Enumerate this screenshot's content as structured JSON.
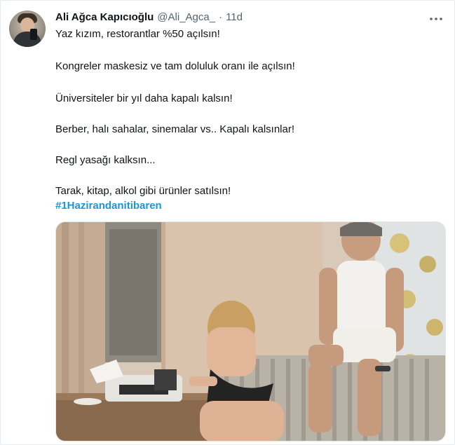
{
  "author": {
    "display_name": "Ali Ağca Kapıcıoğlu",
    "handle": "@Ali_Agca_",
    "separator": "·",
    "time": "11d"
  },
  "tweet": {
    "lines": [
      "Yaz kızım, restorantlar %50 açılsın!",
      "Kongreler maskesiz ve tam doluluk oranı ile açılsın!",
      "Üniversiteler bir yıl daha kapalı kalsın!",
      "Berber, halı sahalar, sinemalar vs.. Kapalı kalsınlar!",
      "Regl yasağı kalksın...",
      "Tarak, kitap, alkol gibi ürünler satılsın!"
    ],
    "hashtag": "#1Hazirandanitibaren"
  },
  "icons": {
    "more": "more-options-icon",
    "avatar": "profile-avatar"
  },
  "colors": {
    "text": "#0f1419",
    "secondary": "#536471",
    "link": "#1b95e0",
    "border": "#e6ecf0"
  }
}
